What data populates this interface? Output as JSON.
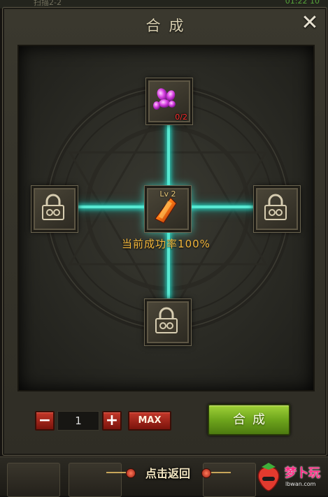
{
  "top_strip": {
    "left_text": "扫描2-2",
    "right_text": "01:22 10"
  },
  "dialog": {
    "title": "合成",
    "close_icon": "close-icon"
  },
  "slots": {
    "top": {
      "item": "purple-crystal-material-icon",
      "count": "0/2"
    },
    "center": {
      "item": "orange-crystal-icon",
      "level": "Lv 2"
    },
    "left": {
      "item": "lock-icon",
      "locked": true
    },
    "right": {
      "item": "lock-icon",
      "locked": true
    },
    "bottom": {
      "item": "lock-icon",
      "locked": true
    }
  },
  "success_rate_text": "当前成功率100%",
  "quantity": {
    "minus": "−",
    "value": "1",
    "plus": "+",
    "max": "MAX"
  },
  "compose_button": "合成",
  "bottom_bar": {
    "return_label": "点击返回"
  },
  "watermark": {
    "text": "梦卜玩",
    "url": "lbwan.com"
  },
  "colors": {
    "beam": "#58e8d2",
    "rate_text": "#f2b53a",
    "compose_green": "#7bb21f",
    "qty_red": "#a8261a"
  }
}
